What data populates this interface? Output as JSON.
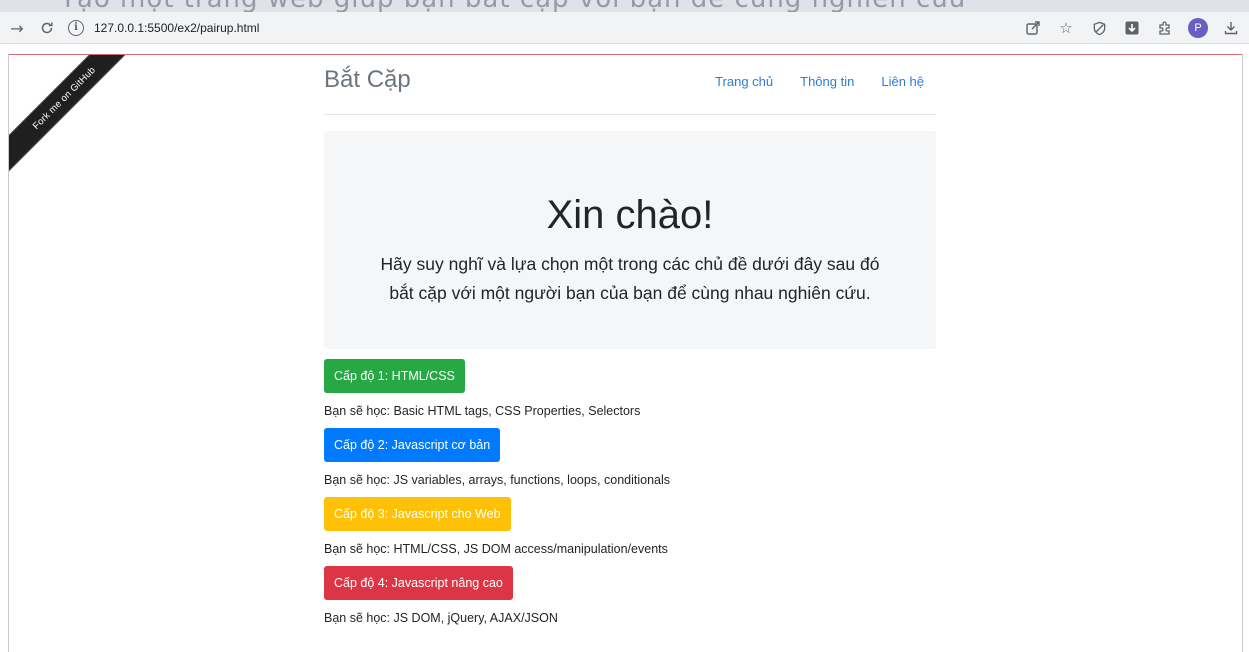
{
  "browser": {
    "url": "127.0.0.1:5500/ex2/pairup.html",
    "icons": [
      "back-icon",
      "reload-icon",
      "site-info-icon",
      "share-icon",
      "star-icon",
      "shield-icon",
      "extension-download-icon",
      "puzzle-icon",
      "profile-avatar",
      "download-icon"
    ],
    "avatar_letter": "P",
    "top_text": "Tạo một trang web giúp bạn bắt cặp với bạn để cùng nghiên cứu"
  },
  "ribbon": {
    "label": "Fork me on GitHub"
  },
  "header": {
    "brand": "Bắt Cặp",
    "nav": [
      "Trang chủ",
      "Thông tin",
      "Liên hệ"
    ]
  },
  "jumbotron": {
    "title": "Xin chào!",
    "line1": "Hãy suy nghĩ và lựa chọn một trong các chủ đề dưới đây sau đó",
    "line2": "bắt cặp với một người bạn của bạn để cùng nhau nghiên cứu."
  },
  "levels": [
    {
      "label": "Cấp độ 1: HTML/CSS",
      "desc": "Bạn sẽ học: Basic HTML tags, CSS Properties, Selectors",
      "color": "#28a745",
      "text_color": "#ffffff"
    },
    {
      "label": "Cấp độ 2: Javascript cơ bản",
      "desc": "Bạn sẽ học: JS variables, arrays, functions, loops, conditionals",
      "color": "#007bff",
      "text_color": "#ffffff"
    },
    {
      "label": "Cấp độ 3: Javascript cho Web",
      "desc": "Bạn sẽ học: HTML/CSS, JS DOM access/manipulation/events",
      "color": "#ffc107",
      "text_color": "#ffffff"
    },
    {
      "label": "Cấp độ 4: Javascript nâng cao",
      "desc": "Bạn sẽ học: JS DOM, jQuery, AJAX/JSON",
      "color": "#dc3545",
      "text_color": "#ffffff"
    }
  ]
}
